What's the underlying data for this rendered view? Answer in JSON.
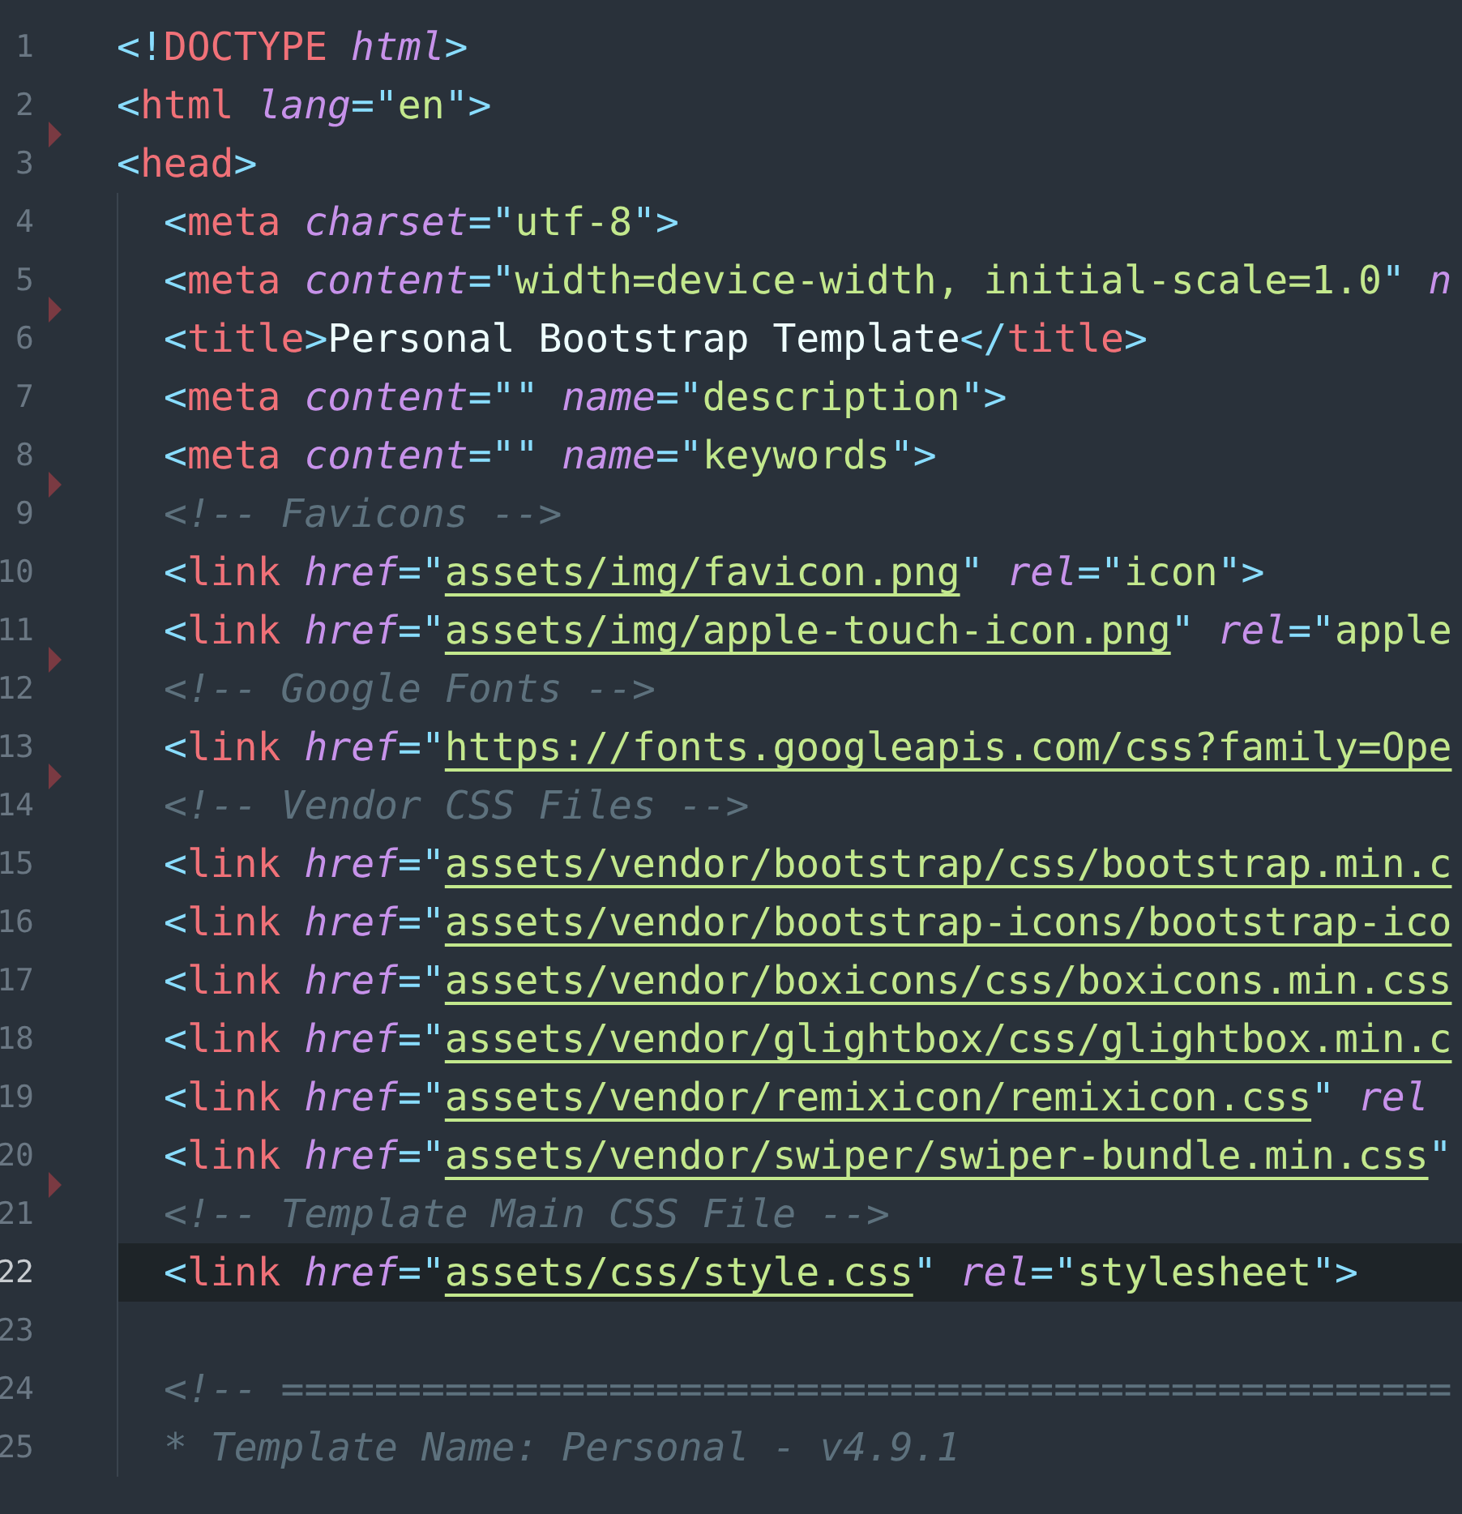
{
  "editor": {
    "lines": [
      {
        "number": "1",
        "selected": false,
        "deleted_above": false,
        "tokens": [
          {
            "kind": "punct",
            "text": "<!"
          },
          {
            "kind": "tag",
            "text": "DOCTYPE "
          },
          {
            "kind": "attr",
            "text": "html"
          },
          {
            "kind": "punct",
            "text": ">"
          }
        ]
      },
      {
        "number": "2",
        "selected": false,
        "deleted_above": false,
        "tokens": [
          {
            "kind": "punct",
            "text": "<"
          },
          {
            "kind": "tag",
            "text": "html "
          },
          {
            "kind": "attr",
            "text": "lang"
          },
          {
            "kind": "punct",
            "text": "=\""
          },
          {
            "kind": "string",
            "text": "en"
          },
          {
            "kind": "punct",
            "text": "\">"
          }
        ]
      },
      {
        "number": "3",
        "selected": false,
        "deleted_above": true,
        "tokens": [
          {
            "kind": "punct",
            "text": "<"
          },
          {
            "kind": "tag",
            "text": "head"
          },
          {
            "kind": "punct",
            "text": ">"
          }
        ],
        "children": [
          {
            "number": "4",
            "selected": false,
            "deleted_above": false,
            "tokens": [
              {
                "kind": "punct",
                "text": "<"
              },
              {
                "kind": "tag",
                "text": "meta "
              },
              {
                "kind": "attr",
                "text": "charset"
              },
              {
                "kind": "punct",
                "text": "=\""
              },
              {
                "kind": "string",
                "text": "utf-8"
              },
              {
                "kind": "punct",
                "text": "\">"
              }
            ]
          },
          {
            "number": "5",
            "selected": false,
            "deleted_above": false,
            "tokens": [
              {
                "kind": "punct",
                "text": "<"
              },
              {
                "kind": "tag",
                "text": "meta "
              },
              {
                "kind": "attr",
                "text": "content"
              },
              {
                "kind": "punct",
                "text": "=\""
              },
              {
                "kind": "string",
                "text": "width=device-width, initial-scale=1.0"
              },
              {
                "kind": "punct",
                "text": "\" "
              },
              {
                "kind": "attr",
                "text": "n"
              }
            ]
          },
          {
            "number": "6",
            "selected": false,
            "deleted_above": true,
            "tokens": [
              {
                "kind": "punct",
                "text": "<"
              },
              {
                "kind": "tag",
                "text": "title"
              },
              {
                "kind": "punct",
                "text": ">"
              },
              {
                "kind": "plain",
                "text": "Personal Bootstrap Template"
              },
              {
                "kind": "punct",
                "text": "</"
              },
              {
                "kind": "tag",
                "text": "title"
              },
              {
                "kind": "punct",
                "text": ">"
              }
            ]
          },
          {
            "number": "7",
            "selected": false,
            "deleted_above": false,
            "tokens": [
              {
                "kind": "punct",
                "text": "<"
              },
              {
                "kind": "tag",
                "text": "meta "
              },
              {
                "kind": "attr",
                "text": "content"
              },
              {
                "kind": "punct",
                "text": "=\"\" "
              },
              {
                "kind": "attr",
                "text": "name"
              },
              {
                "kind": "punct",
                "text": "=\""
              },
              {
                "kind": "string",
                "text": "description"
              },
              {
                "kind": "punct",
                "text": "\">"
              }
            ]
          },
          {
            "number": "8",
            "selected": false,
            "deleted_above": false,
            "tokens": [
              {
                "kind": "punct",
                "text": "<"
              },
              {
                "kind": "tag",
                "text": "meta "
              },
              {
                "kind": "attr",
                "text": "content"
              },
              {
                "kind": "punct",
                "text": "=\"\" "
              },
              {
                "kind": "attr",
                "text": "name"
              },
              {
                "kind": "punct",
                "text": "=\""
              },
              {
                "kind": "string",
                "text": "keywords"
              },
              {
                "kind": "punct",
                "text": "\">"
              }
            ]
          },
          {
            "number": "9",
            "selected": false,
            "deleted_above": true,
            "tokens": [
              {
                "kind": "comment",
                "text": "<!-- Favicons -->"
              }
            ]
          },
          {
            "number": "10",
            "selected": false,
            "deleted_above": false,
            "tokens": [
              {
                "kind": "punct",
                "text": "<"
              },
              {
                "kind": "tag",
                "text": "link "
              },
              {
                "kind": "attr",
                "text": "href"
              },
              {
                "kind": "punct",
                "text": "=\""
              },
              {
                "kind": "url",
                "text": "assets/img/favicon.png"
              },
              {
                "kind": "punct",
                "text": "\" "
              },
              {
                "kind": "attr",
                "text": "rel"
              },
              {
                "kind": "punct",
                "text": "=\""
              },
              {
                "kind": "string",
                "text": "icon"
              },
              {
                "kind": "punct",
                "text": "\">"
              }
            ]
          },
          {
            "number": "11",
            "selected": false,
            "deleted_above": false,
            "tokens": [
              {
                "kind": "punct",
                "text": "<"
              },
              {
                "kind": "tag",
                "text": "link "
              },
              {
                "kind": "attr",
                "text": "href"
              },
              {
                "kind": "punct",
                "text": "=\""
              },
              {
                "kind": "url",
                "text": "assets/img/apple-touch-icon.png"
              },
              {
                "kind": "punct",
                "text": "\" "
              },
              {
                "kind": "attr",
                "text": "rel"
              },
              {
                "kind": "punct",
                "text": "=\""
              },
              {
                "kind": "string",
                "text": "apple"
              }
            ]
          },
          {
            "number": "12",
            "selected": false,
            "deleted_above": true,
            "tokens": [
              {
                "kind": "comment",
                "text": "<!-- Google Fonts -->"
              }
            ]
          },
          {
            "number": "13",
            "selected": false,
            "deleted_above": false,
            "tokens": [
              {
                "kind": "punct",
                "text": "<"
              },
              {
                "kind": "tag",
                "text": "link "
              },
              {
                "kind": "attr",
                "text": "href"
              },
              {
                "kind": "punct",
                "text": "=\""
              },
              {
                "kind": "url",
                "text": "https://fonts.googleapis.com/css?family=Ope"
              }
            ]
          },
          {
            "number": "14",
            "selected": false,
            "deleted_above": true,
            "tokens": [
              {
                "kind": "comment",
                "text": "<!-- Vendor CSS Files -->"
              }
            ]
          },
          {
            "number": "15",
            "selected": false,
            "deleted_above": false,
            "tokens": [
              {
                "kind": "punct",
                "text": "<"
              },
              {
                "kind": "tag",
                "text": "link "
              },
              {
                "kind": "attr",
                "text": "href"
              },
              {
                "kind": "punct",
                "text": "=\""
              },
              {
                "kind": "url",
                "text": "assets/vendor/bootstrap/css/bootstrap.min.c"
              }
            ]
          },
          {
            "number": "16",
            "selected": false,
            "deleted_above": false,
            "tokens": [
              {
                "kind": "punct",
                "text": "<"
              },
              {
                "kind": "tag",
                "text": "link "
              },
              {
                "kind": "attr",
                "text": "href"
              },
              {
                "kind": "punct",
                "text": "=\""
              },
              {
                "kind": "url",
                "text": "assets/vendor/bootstrap-icons/bootstrap-ico"
              }
            ]
          },
          {
            "number": "17",
            "selected": false,
            "deleted_above": false,
            "tokens": [
              {
                "kind": "punct",
                "text": "<"
              },
              {
                "kind": "tag",
                "text": "link "
              },
              {
                "kind": "attr",
                "text": "href"
              },
              {
                "kind": "punct",
                "text": "=\""
              },
              {
                "kind": "url",
                "text": "assets/vendor/boxicons/css/boxicons.min.css"
              }
            ]
          },
          {
            "number": "18",
            "selected": false,
            "deleted_above": false,
            "tokens": [
              {
                "kind": "punct",
                "text": "<"
              },
              {
                "kind": "tag",
                "text": "link "
              },
              {
                "kind": "attr",
                "text": "href"
              },
              {
                "kind": "punct",
                "text": "=\""
              },
              {
                "kind": "url",
                "text": "assets/vendor/glightbox/css/glightbox.min.c"
              }
            ]
          },
          {
            "number": "19",
            "selected": false,
            "deleted_above": false,
            "tokens": [
              {
                "kind": "punct",
                "text": "<"
              },
              {
                "kind": "tag",
                "text": "link "
              },
              {
                "kind": "attr",
                "text": "href"
              },
              {
                "kind": "punct",
                "text": "=\""
              },
              {
                "kind": "url",
                "text": "assets/vendor/remixicon/remixicon.css"
              },
              {
                "kind": "punct",
                "text": "\" "
              },
              {
                "kind": "attr",
                "text": "rel"
              }
            ]
          },
          {
            "number": "20",
            "selected": false,
            "deleted_above": false,
            "tokens": [
              {
                "kind": "punct",
                "text": "<"
              },
              {
                "kind": "tag",
                "text": "link "
              },
              {
                "kind": "attr",
                "text": "href"
              },
              {
                "kind": "punct",
                "text": "=\""
              },
              {
                "kind": "url",
                "text": "assets/vendor/swiper/swiper-bundle.min.css"
              },
              {
                "kind": "punct",
                "text": "\""
              }
            ]
          },
          {
            "number": "21",
            "selected": false,
            "deleted_above": true,
            "tokens": [
              {
                "kind": "comment",
                "text": "<!-- Template Main CSS File -->"
              }
            ]
          },
          {
            "number": "22",
            "selected": true,
            "deleted_above": false,
            "tokens": [
              {
                "kind": "punct",
                "text": "<"
              },
              {
                "kind": "tag",
                "text": "link "
              },
              {
                "kind": "attr",
                "text": "href"
              },
              {
                "kind": "punct",
                "text": "=\""
              },
              {
                "kind": "url",
                "text": "assets/css/style.css"
              },
              {
                "kind": "punct",
                "text": "\" "
              },
              {
                "kind": "attr",
                "text": "rel"
              },
              {
                "kind": "punct",
                "text": "=\""
              },
              {
                "kind": "string",
                "text": "stylesheet"
              },
              {
                "kind": "punct",
                "text": "\">"
              }
            ]
          },
          {
            "number": "23",
            "selected": false,
            "deleted_above": false
          },
          {
            "number": "24",
            "selected": false,
            "deleted_above": false,
            "tokens": [
              {
                "kind": "comment",
                "text": "<!-- =================================================="
              }
            ]
          },
          {
            "number": "25",
            "selected": false,
            "deleted_above": false,
            "tokens": [
              {
                "kind": "comment",
                "text": "* Template Name: Personal - v4.9.1"
              }
            ]
          }
        ]
      }
    ]
  }
}
